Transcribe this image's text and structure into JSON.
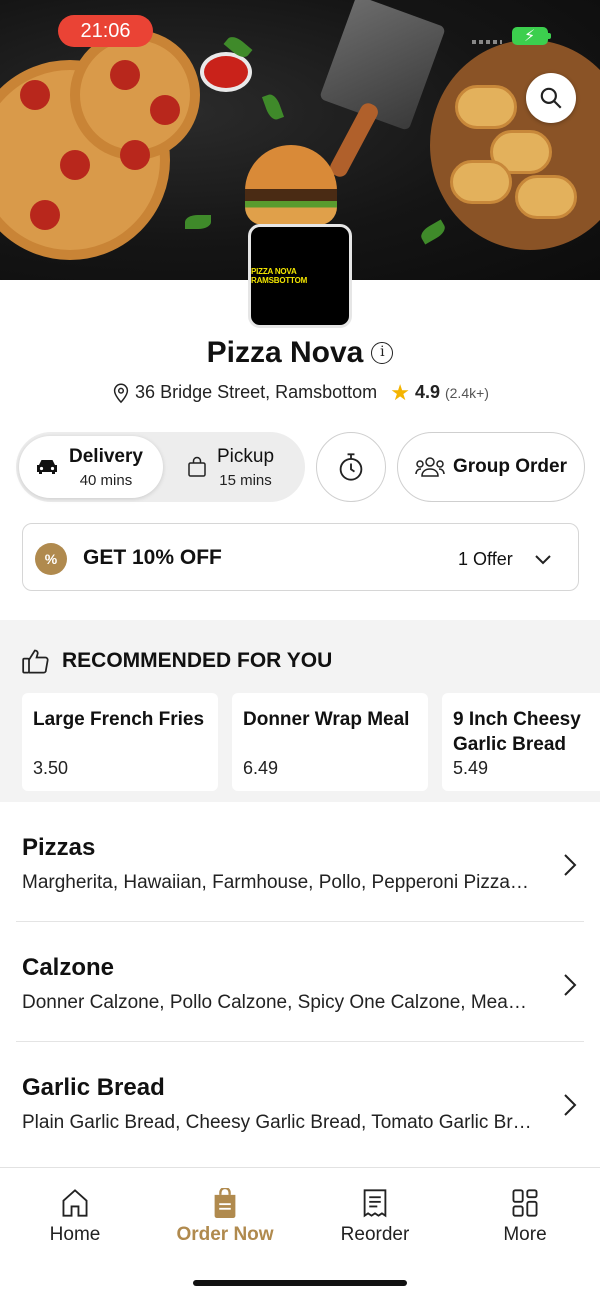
{
  "status_bar": {
    "time": "21:06"
  },
  "hero": {
    "logo_text": "PIZZA NOVA RAMSBOTTOM"
  },
  "store": {
    "name": "Pizza Nova",
    "address": "36 Bridge Street, Ramsbottom",
    "rating": "4.9",
    "rating_count": "(2.4k+)"
  },
  "order_modes": {
    "delivery": {
      "label": "Delivery",
      "time": "40 mins"
    },
    "pickup": {
      "label": "Pickup",
      "time": "15 mins"
    },
    "group_order": "Group Order"
  },
  "offer": {
    "title": "GET 10% OFF",
    "count": "1 Offer",
    "badge": "%"
  },
  "recommended": {
    "heading": "RECOMMENDED FOR YOU",
    "items": [
      {
        "name": "Large French Fries",
        "price": "3.50"
      },
      {
        "name": "Donner Wrap Meal",
        "price": "6.49"
      },
      {
        "name": "9 Inch Cheesy Garlic Bread",
        "price": "5.49"
      }
    ]
  },
  "categories": [
    {
      "name": "Pizzas",
      "items": "Margherita, Hawaiian, Farmhouse, Pollo, Pepperoni Pizza, Meat Feast"
    },
    {
      "name": "Calzone",
      "items": "Donner Calzone, Pollo Calzone, Spicy One Calzone, Meat Calzone"
    },
    {
      "name": "Garlic Bread",
      "items": "Plain Garlic Bread, Cheesy Garlic Bread, Tomato Garlic Bread"
    }
  ],
  "nav": {
    "items": [
      {
        "label": "Home",
        "icon": "home-icon"
      },
      {
        "label": "Order Now",
        "icon": "order-bag-icon"
      },
      {
        "label": "Reorder",
        "icon": "receipt-icon"
      },
      {
        "label": "More",
        "icon": "grid-icon"
      }
    ]
  },
  "colors": {
    "accent": "#b08a4e",
    "time_pill": "#ea4335",
    "battery": "#3ccf4e",
    "star": "#f4b400"
  }
}
